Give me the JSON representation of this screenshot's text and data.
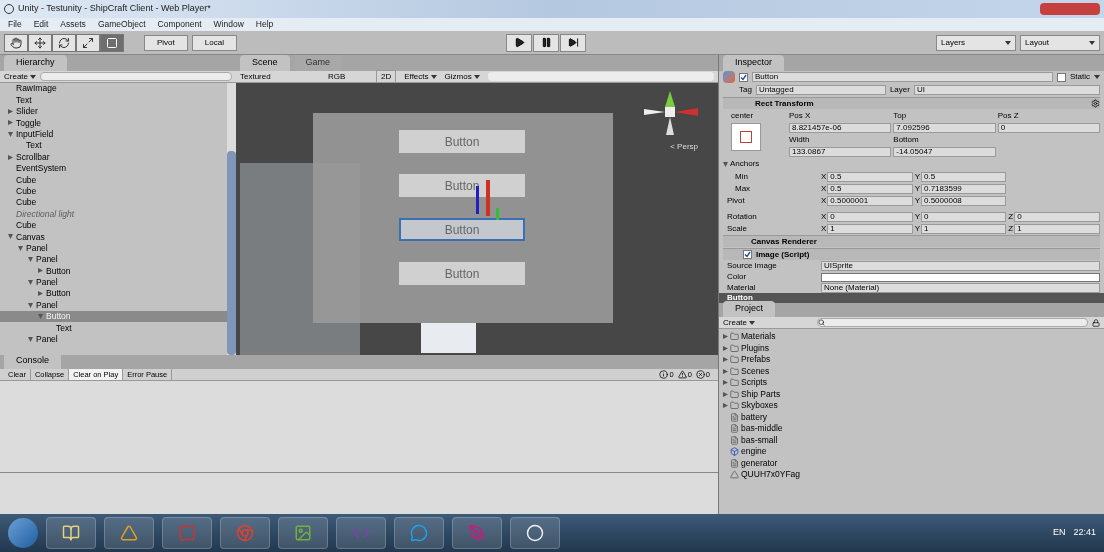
{
  "window": {
    "title": "Unity - Testunity - ShipCraft Client - Web Player*"
  },
  "menu": [
    "File",
    "Edit",
    "Assets",
    "GameObject",
    "Component",
    "Window",
    "Help"
  ],
  "toolbar": {
    "tools": [
      {
        "kind": "hand",
        "selected": false
      },
      {
        "kind": "move",
        "selected": false
      },
      {
        "kind": "rotate",
        "selected": false
      },
      {
        "kind": "scale",
        "selected": false
      },
      {
        "kind": "rect",
        "selected": true
      }
    ],
    "pivot": "Pivot",
    "space": "Local",
    "layers": "Layers",
    "layout": "Layout"
  },
  "hierarchy": {
    "tab": "Hierarchy",
    "create": "Create",
    "items": [
      {
        "name": "RawImage",
        "selected": false,
        "disabled": false
      },
      {
        "name": "Text",
        "selected": false,
        "disabled": false
      },
      {
        "name": "Slider",
        "expanded": false,
        "selected": false,
        "disabled": false
      },
      {
        "name": "Toggle",
        "expanded": false,
        "selected": false,
        "disabled": false
      },
      {
        "name": "InputField",
        "expanded": true,
        "selected": false,
        "disabled": false,
        "children": [
          {
            "name": "Text",
            "selected": false,
            "disabled": false
          }
        ]
      },
      {
        "name": "Scrollbar",
        "expanded": false,
        "selected": false,
        "disabled": false
      },
      {
        "name": "EventSystem",
        "selected": false,
        "disabled": false
      },
      {
        "name": "Cube",
        "selected": false,
        "disabled": false
      },
      {
        "name": "Cube",
        "selected": false,
        "disabled": false
      },
      {
        "name": "Cube",
        "selected": false,
        "disabled": false
      },
      {
        "name": "Directional light",
        "selected": false,
        "disabled": true
      },
      {
        "name": "Cube",
        "selected": false,
        "disabled": false
      },
      {
        "name": "Canvas",
        "expanded": true,
        "selected": false,
        "disabled": false,
        "children": [
          {
            "name": "Panel",
            "expanded": true,
            "selected": false,
            "disabled": false,
            "children": [
              {
                "name": "Panel",
                "expanded": true,
                "selected": false,
                "disabled": false,
                "children": [
                  {
                    "name": "Button",
                    "expanded": false,
                    "selected": false,
                    "disabled": false
                  }
                ]
              },
              {
                "name": "Panel",
                "expanded": true,
                "selected": false,
                "disabled": false,
                "children": [
                  {
                    "name": "Button",
                    "expanded": false,
                    "selected": false,
                    "disabled": false
                  }
                ]
              },
              {
                "name": "Panel",
                "expanded": true,
                "selected": false,
                "disabled": false,
                "children": [
                  {
                    "name": "Button",
                    "expanded": true,
                    "selected": true,
                    "disabled": false,
                    "children": [
                      {
                        "name": "Text",
                        "selected": false,
                        "disabled": false
                      }
                    ]
                  }
                ]
              },
              {
                "name": "Panel",
                "expanded": true,
                "selected": false,
                "disabled": false
              }
            ]
          }
        ]
      }
    ]
  },
  "scene": {
    "tabs": [
      {
        "label": "Scene",
        "selected": true
      },
      {
        "label": "Game",
        "selected": false
      }
    ],
    "shading": "Textured",
    "render_mode": "RGB",
    "mode_2d": "2D",
    "effects": "Effects",
    "gizmos": "Gizmos",
    "buttons": [
      {
        "label": "Button",
        "selected": false
      },
      {
        "label": "Button",
        "selected": false
      },
      {
        "label": "Button",
        "selected": true
      },
      {
        "label": "Button",
        "selected": false
      }
    ],
    "projection": "< Persp"
  },
  "inspector": {
    "tab": "Inspector",
    "object_name": "Button",
    "active": true,
    "static_label": "Static",
    "static": false,
    "tag_label": "Tag",
    "tag": "Untagged",
    "layer_label": "Layer",
    "layer": "UI",
    "rect_transform": {
      "title": "Rect Transform",
      "anchor_preset": "center",
      "headers1": [
        "Pos X",
        "Top",
        "Pos Z"
      ],
      "values1": [
        "8.821457e-06",
        "7.092596",
        "0"
      ],
      "headers2": [
        "Width",
        "Bottom"
      ],
      "values2": [
        "133.0867",
        "-14.05047"
      ],
      "anchors_label": "Anchors",
      "rows": [
        {
          "label": "Min",
          "fields": [
            [
              "X",
              "0.5"
            ],
            [
              "Y",
              "0.5"
            ]
          ]
        },
        {
          "label": "Max",
          "fields": [
            [
              "X",
              "0.5"
            ],
            [
              "Y",
              "0.7183599"
            ]
          ]
        },
        {
          "label": "Pivot",
          "fields": [
            [
              "X",
              "0.5000001"
            ],
            [
              "Y",
              "0.5000008"
            ]
          ]
        },
        {
          "label": "Rotation",
          "fields": [
            [
              "X",
              "0"
            ],
            [
              "Y",
              "0"
            ],
            [
              "Z",
              "0"
            ]
          ]
        },
        {
          "label": "Scale",
          "fields": [
            [
              "X",
              "1"
            ],
            [
              "Y",
              "1"
            ],
            [
              "Z",
              "1"
            ]
          ]
        }
      ]
    },
    "canvas_renderer": "Canvas Renderer",
    "image": {
      "title": "Image (Script)",
      "enabled": true,
      "source_label": "Source Image",
      "source": "UISprite",
      "color_label": "Color",
      "color": "#ffffff",
      "material_label": "Material",
      "material": "None (Material)"
    },
    "preview": "Button"
  },
  "project": {
    "tab": "Project",
    "create": "Create",
    "items": [
      {
        "kind": "folder",
        "name": "Materials"
      },
      {
        "kind": "folder",
        "name": "Plugins"
      },
      {
        "kind": "folder",
        "name": "Prefabs"
      },
      {
        "kind": "folder",
        "name": "Scenes"
      },
      {
        "kind": "folder",
        "name": "Scripts"
      },
      {
        "kind": "folder",
        "name": "Ship Parts"
      },
      {
        "kind": "folder",
        "name": "Skyboxes"
      },
      {
        "kind": "file",
        "name": "battery"
      },
      {
        "kind": "file",
        "name": "bas-middle"
      },
      {
        "kind": "file",
        "name": "bas-small"
      },
      {
        "kind": "prefab",
        "name": "engine"
      },
      {
        "kind": "file",
        "name": "generator"
      },
      {
        "kind": "model",
        "name": "QUUH7x0YFag"
      }
    ]
  },
  "console": {
    "tab": "Console",
    "buttons": [
      {
        "label": "Clear",
        "on": false
      },
      {
        "label": "Collapse",
        "on": false
      },
      {
        "label": "Clear on Play",
        "on": true
      },
      {
        "label": "Error Pause",
        "on": false
      }
    ],
    "counts": [
      {
        "kind": "info",
        "value": "0"
      },
      {
        "kind": "warning",
        "value": "0"
      },
      {
        "kind": "error",
        "value": "0"
      }
    ]
  },
  "taskbar": {
    "apps": [
      {
        "kind": "explorer"
      },
      {
        "kind": "launcher"
      },
      {
        "kind": "red"
      },
      {
        "kind": "browser"
      },
      {
        "kind": "paint"
      },
      {
        "kind": "ide"
      },
      {
        "kind": "chat"
      },
      {
        "kind": "pen"
      },
      {
        "kind": "unity"
      }
    ],
    "language": "EN",
    "time": "22:41"
  }
}
